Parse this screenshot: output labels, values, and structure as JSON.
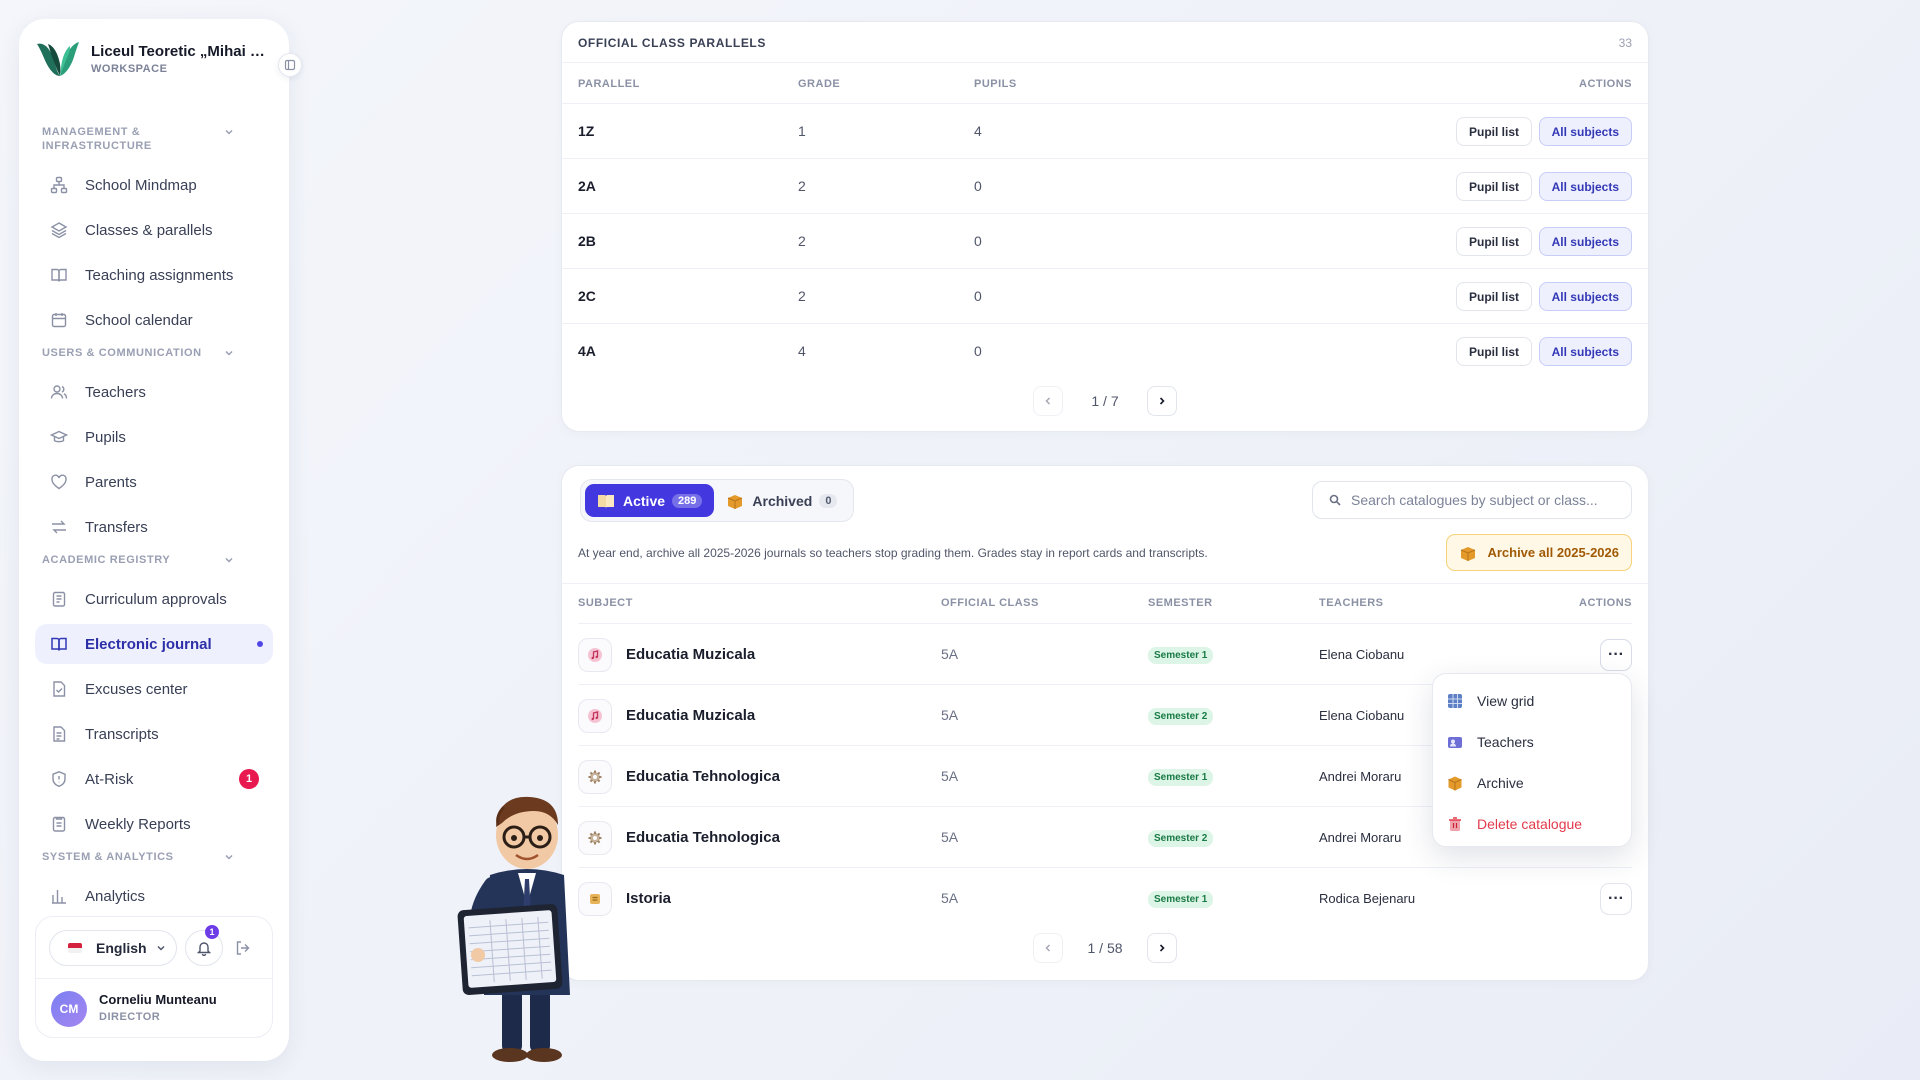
{
  "sidebar": {
    "school_name": "Liceul Teoretic „Mihai Eminescu”",
    "workspace_label": "WORKSPACE",
    "sections": [
      {
        "title": "MANAGEMENT & INFRASTRUCTURE",
        "items": [
          {
            "label": "School Mindmap",
            "icon": "hierarchy-icon"
          },
          {
            "label": "Classes & parallels",
            "icon": "layers-icon"
          },
          {
            "label": "Teaching assignments",
            "icon": "book-open-icon"
          },
          {
            "label": "School calendar",
            "icon": "calendar-icon"
          }
        ]
      },
      {
        "title": "USERS & COMMUNICATION",
        "items": [
          {
            "label": "Teachers",
            "icon": "users-icon"
          },
          {
            "label": "Pupils",
            "icon": "graduation-cap-icon"
          },
          {
            "label": "Parents",
            "icon": "heart-icon"
          },
          {
            "label": "Transfers",
            "icon": "arrows-swap-icon"
          }
        ]
      },
      {
        "title": "ACADEMIC REGISTRY",
        "items": [
          {
            "label": "Curriculum approvals",
            "icon": "clipboard-icon"
          },
          {
            "label": "Electronic journal",
            "icon": "book-open-icon",
            "active": true
          },
          {
            "label": "Excuses center",
            "icon": "file-check-icon"
          },
          {
            "label": "Transcripts",
            "icon": "document-icon"
          },
          {
            "label": "At-Risk",
            "icon": "shield-icon",
            "badge": "1"
          },
          {
            "label": "Weekly Reports",
            "icon": "report-icon"
          }
        ]
      },
      {
        "title": "SYSTEM & ANALYTICS",
        "items": [
          {
            "label": "Analytics",
            "icon": "bar-chart-icon"
          }
        ]
      }
    ],
    "language": "English",
    "notifications_count": "1",
    "user": {
      "initials": "CM",
      "name": "Corneliu Munteanu",
      "role": "DIRECTOR"
    }
  },
  "parallels": {
    "title": "OFFICIAL CLASS PARALLELS",
    "count": "33",
    "headers": {
      "parallel": "PARALLEL",
      "grade": "GRADE",
      "pupils": "PUPILS",
      "actions": "ACTIONS"
    },
    "rows": [
      {
        "parallel": "1Z",
        "grade": "1",
        "pupils": "4"
      },
      {
        "parallel": "2A",
        "grade": "2",
        "pupils": "0"
      },
      {
        "parallel": "2B",
        "grade": "2",
        "pupils": "0"
      },
      {
        "parallel": "2C",
        "grade": "2",
        "pupils": "0"
      },
      {
        "parallel": "4A",
        "grade": "4",
        "pupils": "0"
      }
    ],
    "pupil_list_label": "Pupil list",
    "all_subjects_label": "All subjects",
    "page": "1 / 7"
  },
  "catalogues": {
    "tabs": [
      {
        "label": "Active",
        "count": "289"
      },
      {
        "label": "Archived",
        "count": "0"
      }
    ],
    "search_placeholder": "Search catalogues by subject or class...",
    "info": "At year end, archive all 2025-2026 journals so teachers stop grading them. Grades stay in report cards and transcripts.",
    "archive_all_label": "Archive all 2025-2026",
    "headers": {
      "subject": "SUBJECT",
      "class": "OFFICIAL CLASS",
      "semester": "SEMESTER",
      "teachers": "TEACHERS",
      "actions": "ACTIONS"
    },
    "rows": [
      {
        "subject": "Educatia Muzicala",
        "class": "5A",
        "semester": "Semester 1",
        "teacher": "Elena Ciobanu",
        "icon": "music-icon"
      },
      {
        "subject": "Educatia Muzicala",
        "class": "5A",
        "semester": "Semester 2",
        "teacher": "Elena Ciobanu",
        "icon": "music-icon"
      },
      {
        "subject": "Educatia Tehnologica",
        "class": "5A",
        "semester": "Semester 1",
        "teacher": "Andrei Moraru",
        "icon": "gear-icon"
      },
      {
        "subject": "Educatia Tehnologica",
        "class": "5A",
        "semester": "Semester 2",
        "teacher": "Andrei Moraru",
        "icon": "gear-icon"
      },
      {
        "subject": "Istoria",
        "class": "5A",
        "semester": "Semester 1",
        "teacher": "Rodica Bejenaru",
        "icon": "scroll-icon"
      }
    ],
    "more_label": "···",
    "page": "1 / 58",
    "menu": [
      {
        "label": "View grid",
        "icon": "grid-icon",
        "color": "#5d7fc4"
      },
      {
        "label": "Teachers",
        "icon": "teachers-icon",
        "color": "#6d6fd6"
      },
      {
        "label": "Archive",
        "icon": "box-icon",
        "color": "#e39a2a"
      },
      {
        "label": "Delete catalogue",
        "icon": "trash-icon",
        "color": "#e23a4b",
        "danger": true
      }
    ]
  },
  "colors": {
    "accent": "#4338e0",
    "danger": "#e8194f",
    "success_bg": "#dcf5e6"
  }
}
